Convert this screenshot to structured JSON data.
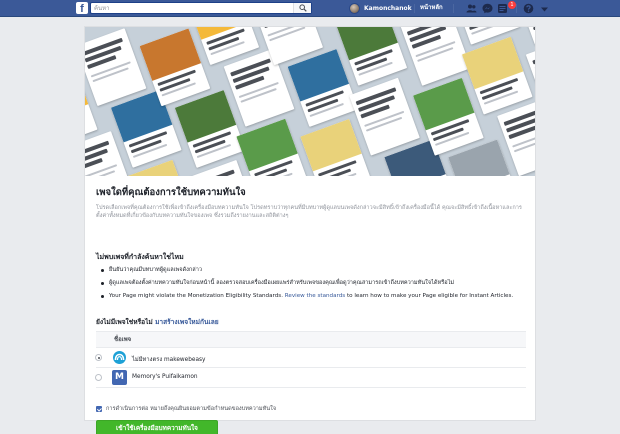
{
  "topbar": {
    "logo_letter": "f",
    "search_placeholder": "ค้นหา",
    "profile_name": "Kamonchanok",
    "home_label": "หน้าหลัก",
    "notification_count": "1"
  },
  "main": {
    "title": "เพจใดที่คุณต้องการใช้บทความทันใจ",
    "description": "โปรดเลือกเพจที่คุณต้องการใช้เพื่อเข้าถึงเครื่องมือบทความทันใจ โปรดทราบว่าทุกคนที่มีบทบาทผู้ดูแลบนเพจดังกล่าวจะมีสิทธิ์เข้าถึงเครื่องมือนี้ได้ คุณจะมีสิทธิ์เข้าถึงเนื้อหาและการตั้งค่าทั้งหมดที่เกี่ยวข้องกับบทความทันใจของเพจ ซึ่งรวมถึงรายงานและสถิติต่างๆ",
    "missing_heading": "ไม่พบเพจที่กำลังค้นหาใช่ไหม",
    "bullets": [
      "ยืนยันว่าคุณมีบทบาทผู้ดูแลเพจดังกล่าว",
      "ผู้ดูแลเพจต้องตั้งค่าบทความทันใจก่อนหน้านี้ ลองตรวจสอบเครื่องมือเผยแพร่สำหรับเพจของคุณเพื่อดูว่าคุณสามารถเข้าถึงบทความทันใจได้หรือไม่"
    ],
    "ineligible_prefix": "Your Page might violate the Monetization Eligibility Standards.",
    "ineligible_link": "Review the standards",
    "ineligible_suffix": "to learn how to make your Page eligible for Instant Articles.",
    "no_page_prefix": "ยังไม่มีเพจใช่หรือไม่",
    "create_page_link": "มาสร้างเพจใหม่กันเลย",
    "table_header": "ชื่อเพจ",
    "pages": [
      {
        "name": "ไม่มีทางตรง makewebeasy",
        "selected": true,
        "color": "#1da1d6"
      },
      {
        "name": "Memory's Puifaikamon",
        "selected": false,
        "color": "#4267b2",
        "letter": "M"
      }
    ],
    "agree_text": "การดำเนินการต่อ หมายถึงคุณยินยอมตามข้อกำหนดของบทความทันใจ",
    "submit_label": "เข้าใช้เครื่องมือบทความทันใจ"
  },
  "colors": {
    "brand": "#3b5998",
    "link": "#365899",
    "button": "#42b72a",
    "badge": "#fa3e3e"
  }
}
